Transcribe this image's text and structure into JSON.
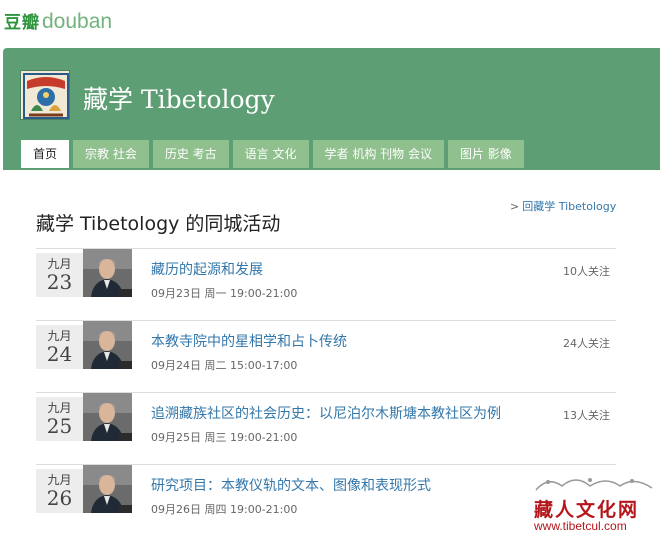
{
  "site": {
    "logo_cn": "豆瓣",
    "logo_en": "douban"
  },
  "group": {
    "title": "藏学 Tibetology"
  },
  "tabs": [
    {
      "label": "首页",
      "active": true
    },
    {
      "label": "宗教 社会",
      "active": false
    },
    {
      "label": "历史 考古",
      "active": false
    },
    {
      "label": "语言 文化",
      "active": false
    },
    {
      "label": "学者 机构 刊物 会议",
      "active": false
    },
    {
      "label": "图片 影像",
      "active": false
    }
  ],
  "page": {
    "title": "藏学 Tibetology 的同城活动",
    "back_arrow": ">",
    "back_link": "回藏学 Tibetology"
  },
  "events": [
    {
      "month": "九月",
      "day": "23",
      "title": "藏历的起源和发展",
      "time": "09月23日 周一 19:00-21:00",
      "follow": "10人关注"
    },
    {
      "month": "九月",
      "day": "24",
      "title": "本教寺院中的星相学和占卜传统",
      "time": "09月24日 周二 15:00-17:00",
      "follow": "24人关注"
    },
    {
      "month": "九月",
      "day": "25",
      "title": "追溯藏族社区的社会历史：以尼泊尔木斯塘本教社区为例",
      "time": "09月25日 周三 19:00-21:00",
      "follow": "13人关注"
    },
    {
      "month": "九月",
      "day": "26",
      "title": "研究项目：本教仪轨的文本、图像和表现形式",
      "time": "09月26日 周四 19:00-21:00",
      "follow": ""
    }
  ],
  "watermark": {
    "cn": "藏人文化网",
    "url": "www.tibetcul.com"
  },
  "colors": {
    "banner": "#5e9e74",
    "tab": "#8fc08d",
    "link": "#3377aa",
    "watermark": "#b5161b"
  }
}
